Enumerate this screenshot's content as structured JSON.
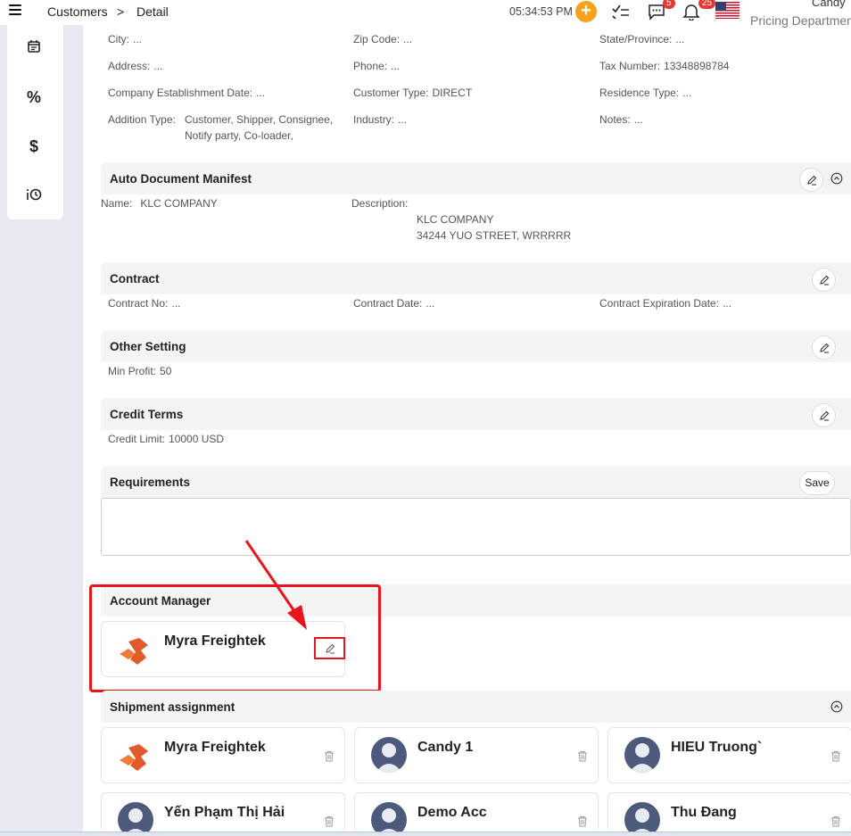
{
  "header": {
    "breadcrumb": [
      "Customers",
      ">",
      "Detail"
    ],
    "clock": "05:34:53 PM",
    "messages_badge": "5",
    "notifications_badge": "25",
    "user_name": "Candy",
    "user_role": "Pricing Departmen"
  },
  "customer_info": {
    "city": {
      "label": "City:",
      "value": "..."
    },
    "zip": {
      "label": "Zip Code:",
      "value": "..."
    },
    "state": {
      "label": "State/Province:",
      "value": "..."
    },
    "address": {
      "label": "Address:",
      "value": "..."
    },
    "phone": {
      "label": "Phone:",
      "value": "..."
    },
    "tax": {
      "label": "Tax Number:",
      "value": "13348898784"
    },
    "established": {
      "label": "Company Establishment Date:",
      "value": "..."
    },
    "customer_type": {
      "label": "Customer Type:",
      "value": "DIRECT"
    },
    "residence_type": {
      "label": "Residence Type:",
      "value": "..."
    },
    "addition_type": {
      "label": "Addition Type:",
      "value_line1": "Customer, Shipper, Consignee,",
      "value_line2": "Notify party, Co-loader,"
    },
    "industry": {
      "label": "Industry:",
      "value": "..."
    },
    "notes": {
      "label": "Notes:",
      "value": "..."
    }
  },
  "auto_manifest": {
    "title": "Auto Document Manifest",
    "name_label": "Name:",
    "name_value": "KLC COMPANY",
    "desc_label": "Description:",
    "desc_line1": "KLC COMPANY",
    "desc_line2": "34244 YUO STREET, WRRRRR"
  },
  "contract": {
    "title": "Contract",
    "no_label": "Contract No:",
    "no_value": "...",
    "date_label": "Contract Date:",
    "date_value": "...",
    "exp_label": "Contract Expiration Date:",
    "exp_value": "..."
  },
  "other_setting": {
    "title": "Other Setting",
    "min_profit_label": "Min Profit:",
    "min_profit_value": "50"
  },
  "credit_terms": {
    "title": "Credit Terms",
    "limit_label": "Credit Limit:",
    "limit_value": "10000 USD"
  },
  "requirements": {
    "title": "Requirements",
    "save_label": "Save",
    "text": ""
  },
  "account_manager": {
    "title": "Account Manager",
    "name": "Myra Freightek"
  },
  "shipment_assignment": {
    "title": "Shipment assignment",
    "people": [
      {
        "name": "Myra Freightek",
        "avatar": "company-logo"
      },
      {
        "name": "Candy 1",
        "avatar": "default-avatar"
      },
      {
        "name": "HIEU Truong`",
        "avatar": "default-avatar"
      },
      {
        "name": "Yến Phạm Thị Hải",
        "avatar": "default-avatar"
      },
      {
        "name": "Demo Acc",
        "avatar": "default-avatar"
      },
      {
        "name": "Thu Đang",
        "avatar": "default-avatar"
      }
    ]
  },
  "colors": {
    "accent_orange": "#f7a21b",
    "badge_red": "#e53935",
    "annotation_red": "#e8161c",
    "sidebar_bg": "#e8e8f3"
  }
}
